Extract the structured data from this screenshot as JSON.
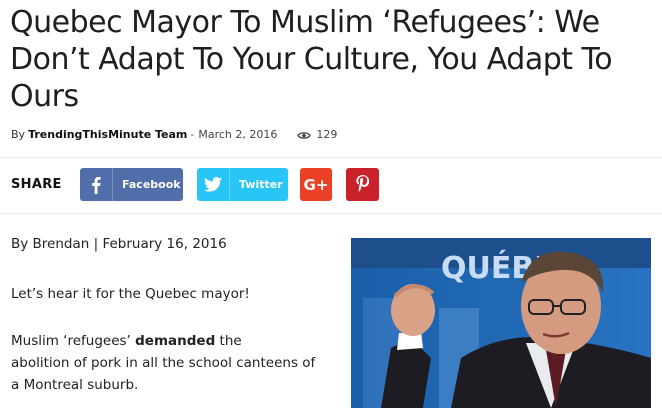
{
  "article": {
    "title": "Quebec Mayor To Muslim ‘Refugees’: We Don’t Adapt To Your Culture, You Adapt To Ours",
    "by_prefix": "By",
    "author": "TrendingThisMinute Team",
    "separator": "-",
    "date": "March 2, 2016",
    "view_icon": "eye-icon",
    "views": "129"
  },
  "share": {
    "label": "SHARE",
    "facebook_label": "Facebook",
    "twitter_label": "Twitter",
    "gplus_label": "G+",
    "colors": {
      "facebook": "#516eab",
      "twitter": "#29c5f6",
      "gplus": "#eb4026",
      "pinterest": "#ca212a"
    }
  },
  "content": {
    "byline": "By Brendan | February 16, 2016",
    "para1": "Let’s hear it for the Quebec mayor!",
    "para2_start": "Muslim ‘refugees’ ",
    "para2_bold": "demanded",
    "para2_end": " the",
    "para2_line2": "abolition of pork in all the school canteens of",
    "para2_line3": "a Montreal suburb.",
    "photo_sign_text": "QUÉBEC"
  }
}
